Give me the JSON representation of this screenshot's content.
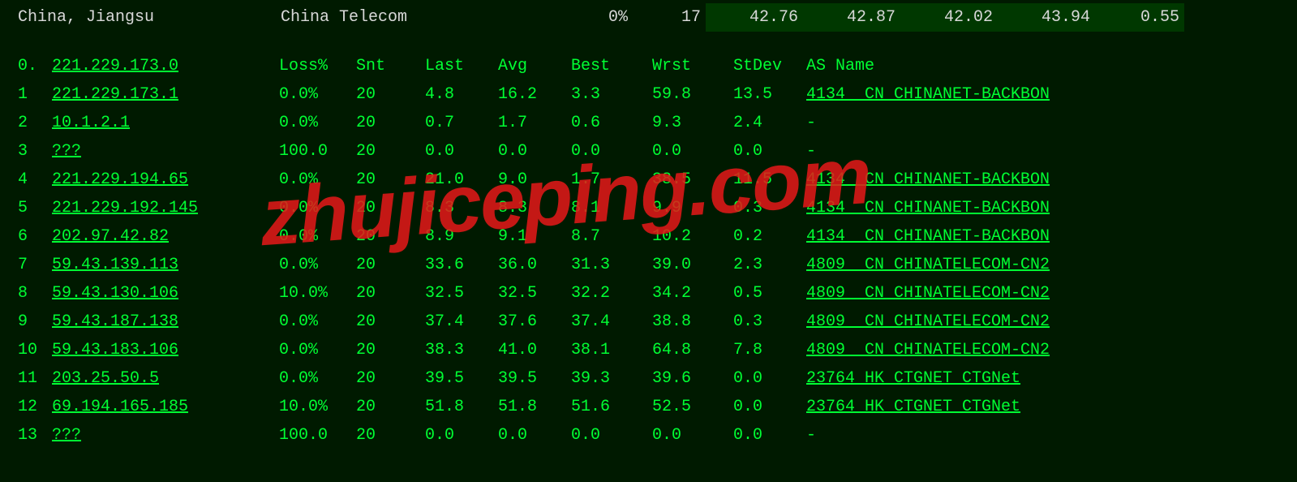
{
  "header": {
    "location": "China, Jiangsu",
    "isp": "China Telecom",
    "loss": "0%",
    "snt": "17",
    "v1": "42.76",
    "v2": "42.87",
    "v3": "42.02",
    "v4": "43.94",
    "v5": "0.55"
  },
  "columns": {
    "idx": "0.",
    "host": "221.229.173.0",
    "loss": "Loss%",
    "snt": "Snt",
    "last": "Last",
    "avg": "Avg",
    "best": "Best",
    "wrst": "Wrst",
    "stdev": "StDev",
    "asname": "AS Name"
  },
  "hops": [
    {
      "idx": "1",
      "host": "221.229.173.1",
      "loss": "0.0%",
      "snt": "20",
      "last": "4.8",
      "avg": "16.2",
      "best": "3.3",
      "wrst": "59.8",
      "stdev": "13.5",
      "as": "4134",
      "cc": "CN",
      "name": "CHINANET-BACKBON"
    },
    {
      "idx": "2",
      "host": "10.1.2.1",
      "loss": "0.0%",
      "snt": "20",
      "last": "0.7",
      "avg": "1.7",
      "best": "0.6",
      "wrst": "9.3",
      "stdev": "2.4",
      "as": "",
      "cc": "",
      "name": "-"
    },
    {
      "idx": "3",
      "host": "???",
      "loss": "100.0",
      "snt": "20",
      "last": "0.0",
      "avg": "0.0",
      "best": "0.0",
      "wrst": "0.0",
      "stdev": "0.0",
      "as": "",
      "cc": "",
      "name": "-"
    },
    {
      "idx": "4",
      "host": "221.229.194.65",
      "loss": "0.0%",
      "snt": "20",
      "last": "21.0",
      "avg": "9.0",
      "best": "1.7",
      "wrst": "38.5",
      "stdev": "11.5",
      "as": "4134",
      "cc": "CN",
      "name": "CHINANET-BACKBON"
    },
    {
      "idx": "5",
      "host": "221.229.192.145",
      "loss": "0.0%",
      "snt": "20",
      "last": "8.3",
      "avg": "8.3",
      "best": "8.1",
      "wrst": "9.9",
      "stdev": "0.3",
      "as": "4134",
      "cc": "CN",
      "name": "CHINANET-BACKBON"
    },
    {
      "idx": "6",
      "host": "202.97.42.82",
      "loss": "0.0%",
      "snt": "20",
      "last": "8.9",
      "avg": "9.1",
      "best": "8.7",
      "wrst": "10.2",
      "stdev": "0.2",
      "as": "4134",
      "cc": "CN",
      "name": "CHINANET-BACKBON"
    },
    {
      "idx": "7",
      "host": "59.43.139.113",
      "loss": "0.0%",
      "snt": "20",
      "last": "33.6",
      "avg": "36.0",
      "best": "31.3",
      "wrst": "39.0",
      "stdev": "2.3",
      "as": "4809",
      "cc": "CN",
      "name": "CHINATELECOM-CN2"
    },
    {
      "idx": "8",
      "host": "59.43.130.106",
      "loss": "10.0%",
      "snt": "20",
      "last": "32.5",
      "avg": "32.5",
      "best": "32.2",
      "wrst": "34.2",
      "stdev": "0.5",
      "as": "4809",
      "cc": "CN",
      "name": "CHINATELECOM-CN2"
    },
    {
      "idx": "9",
      "host": "59.43.187.138",
      "loss": "0.0%",
      "snt": "20",
      "last": "37.4",
      "avg": "37.6",
      "best": "37.4",
      "wrst": "38.8",
      "stdev": "0.3",
      "as": "4809",
      "cc": "CN",
      "name": "CHINATELECOM-CN2"
    },
    {
      "idx": "10",
      "host": "59.43.183.106",
      "loss": "0.0%",
      "snt": "20",
      "last": "38.3",
      "avg": "41.0",
      "best": "38.1",
      "wrst": "64.8",
      "stdev": "7.8",
      "as": "4809",
      "cc": "CN",
      "name": "CHINATELECOM-CN2"
    },
    {
      "idx": "11",
      "host": "203.25.50.5",
      "loss": "0.0%",
      "snt": "20",
      "last": "39.5",
      "avg": "39.5",
      "best": "39.3",
      "wrst": "39.6",
      "stdev": "0.0",
      "as": "23764",
      "cc": "HK",
      "name": "CTGNET CTGNet"
    },
    {
      "idx": "12",
      "host": "69.194.165.185",
      "loss": "10.0%",
      "snt": "20",
      "last": "51.8",
      "avg": "51.8",
      "best": "51.6",
      "wrst": "52.5",
      "stdev": "0.0",
      "as": "23764",
      "cc": "HK",
      "name": "CTGNET CTGNet"
    },
    {
      "idx": "13",
      "host": "???",
      "loss": "100.0",
      "snt": "20",
      "last": "0.0",
      "avg": "0.0",
      "best": "0.0",
      "wrst": "0.0",
      "stdev": "0.0",
      "as": "",
      "cc": "",
      "name": "-"
    }
  ],
  "watermark": "zhujiceping.com"
}
